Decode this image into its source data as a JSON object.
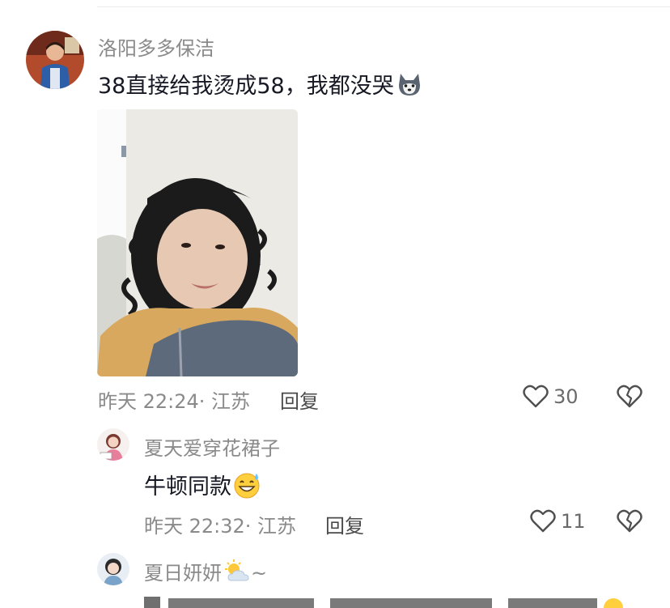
{
  "comments": [
    {
      "user": "洛阳多多保洁",
      "text": "38直接给我烫成58，我都没哭",
      "text_emoji": "husky-emoji",
      "time_location": "昨天 22:24· 江苏",
      "reply_label": "回复",
      "likes": "30"
    }
  ],
  "replies": [
    {
      "user": "夏天爱穿花裙子",
      "text": "牛顿同款",
      "text_emoji": "grinning-sweat-emoji",
      "time_location": "昨天 22:32· 江苏",
      "reply_label": "回复",
      "likes": "11"
    },
    {
      "user": "夏日妍妍",
      "user_suffix": "~",
      "user_emoji": "sun-behind-cloud-emoji"
    }
  ],
  "icons": {
    "like": "heart-outline-icon",
    "dislike": "broken-heart-icon"
  }
}
